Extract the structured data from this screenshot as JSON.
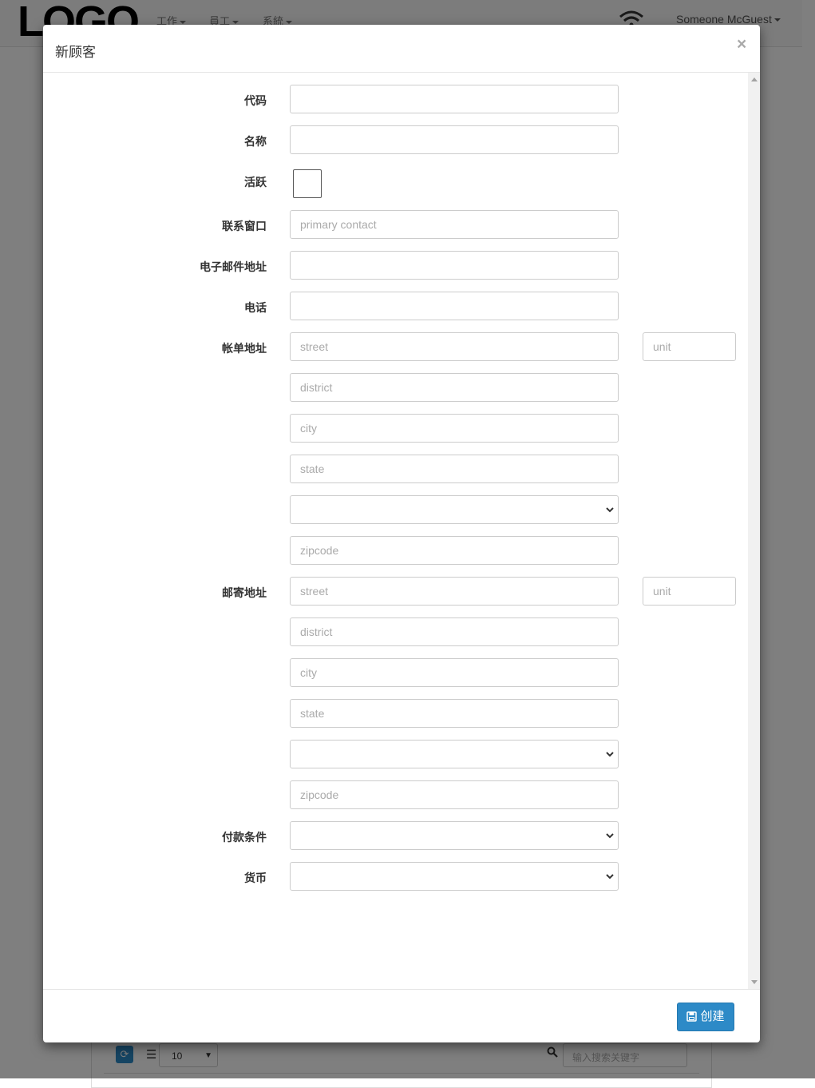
{
  "navbar": {
    "logo": "LOGO",
    "menus": [
      {
        "label": "工作"
      },
      {
        "label": "員工"
      },
      {
        "label": "系統"
      }
    ],
    "user": "Someone McGuest"
  },
  "background": {
    "page_size": "10",
    "search_placeholder": "输入搜索关键字"
  },
  "modal": {
    "title": "新顾客",
    "close": "×",
    "labels": {
      "code": "代码",
      "name": "名称",
      "active": "活跃",
      "contact": "联系窗口",
      "email": "电子邮件地址",
      "phone": "电话",
      "billing": "帐单地址",
      "mailing": "邮寄地址",
      "payment_terms": "付款条件",
      "currency": "货币"
    },
    "fields": {
      "code": "",
      "name": "",
      "contact_placeholder": "primary contact",
      "email": "",
      "phone": "",
      "active": false
    },
    "billing_address": {
      "street": "street",
      "unit": "unit",
      "district": "district",
      "city": "city",
      "state": "state",
      "country": "",
      "zipcode": "zipcode"
    },
    "mailing_address": {
      "street": "street",
      "unit": "unit",
      "district": "district",
      "city": "city",
      "state": "state",
      "country": "",
      "zipcode": "zipcode"
    },
    "payment_terms": "",
    "currency": "",
    "create_label": "创建"
  },
  "colors": {
    "primary": "#2d8ac7",
    "backdrop": "rgba(0,0,0,0.5)"
  }
}
